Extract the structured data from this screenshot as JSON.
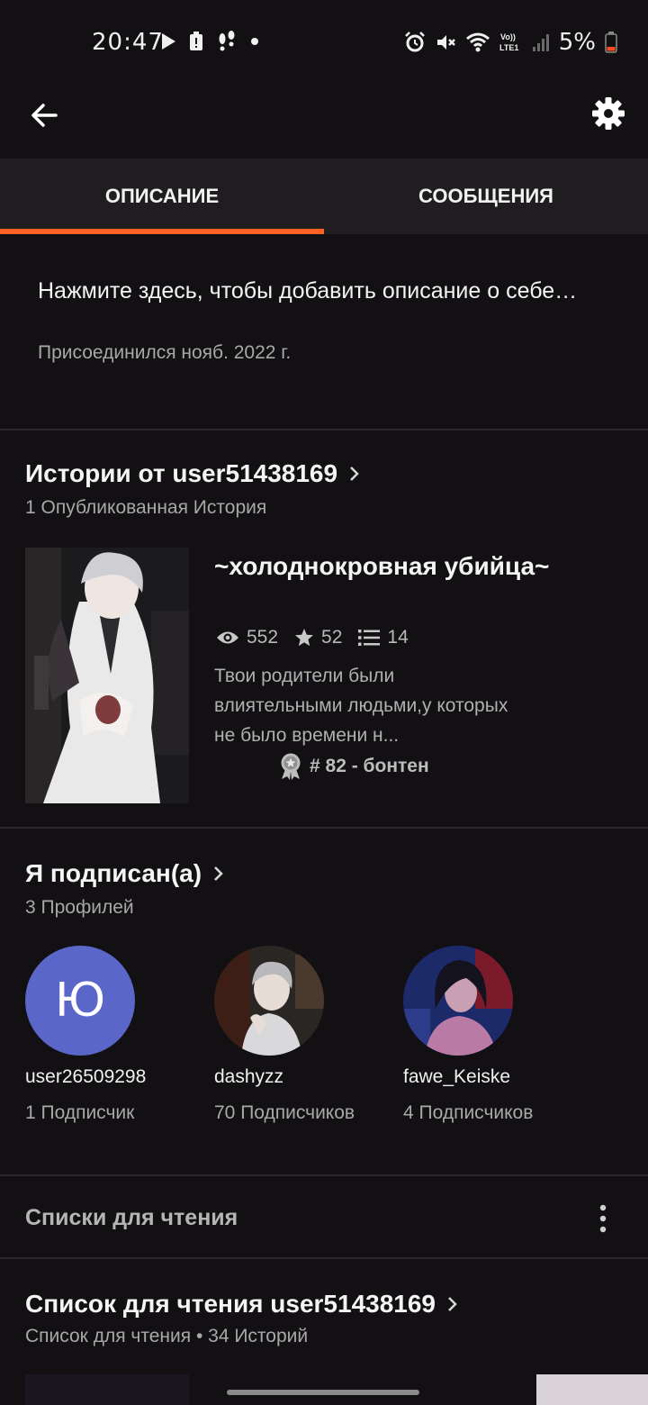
{
  "status_bar": {
    "time": "20:47",
    "left_icons": [
      "play-icon",
      "alert-icon",
      "footsteps-icon",
      "dot-icon"
    ],
    "right_icons": [
      "alarm-icon",
      "mute-icon",
      "wifi-icon",
      "volte-icon",
      "signal-icon",
      "battery-icon"
    ],
    "volte_label": "Vo))\nLTE1",
    "battery_text": "5%"
  },
  "app_bar": {
    "back_icon": "back-arrow-icon",
    "settings_icon": "gear-icon"
  },
  "tabs": [
    {
      "label": "ОПИСАНИЕ",
      "active": true
    },
    {
      "label": "СООБЩЕНИЯ",
      "active": false
    }
  ],
  "colors": {
    "accent": "#ff6122",
    "background": "#121013",
    "tab_bar": "#1f1d20",
    "avatar_letter_bg": "#5a66c8"
  },
  "about": {
    "description_placeholder": "Нажмите здесь, чтобы добавить описание о себе…",
    "joined": "Присоединился нояб. 2022 г."
  },
  "stories": {
    "title": "Истории от user51438169",
    "subtitle": "1 Опубликованная История",
    "items": [
      {
        "title": "~холоднокровная убийца~",
        "reads": "552",
        "votes": "52",
        "parts": "14",
        "description": "Твои родители были влиятельными людьми,у которых не было времени н...",
        "rank": "# 82 - бонтен"
      }
    ]
  },
  "following": {
    "title": "Я подписан(а)",
    "subtitle": "3 Профилей",
    "profiles": [
      {
        "avatar_letter": "Ю",
        "name": "user26509298",
        "followers": "1 Подписчик"
      },
      {
        "name": "dashyzz",
        "followers": "70 Подписчиков"
      },
      {
        "name": "fawe_Keiske",
        "followers": "4 Подписчиков"
      }
    ]
  },
  "reading_lists": {
    "header": "Списки для чтения",
    "more_icon": "more-vertical-icon",
    "items": [
      {
        "title": "Список для чтения user51438169",
        "subtitle": "Список для чтения • 34 Историй"
      }
    ]
  }
}
